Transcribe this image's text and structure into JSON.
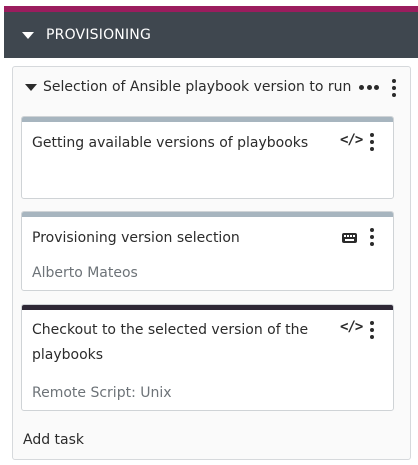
{
  "colors": {
    "accent": "#9b1d5e",
    "header_bg": "#3f474f",
    "card_bar_pending": "#a7b5bf",
    "card_bar_active": "#2f2836"
  },
  "section": {
    "title": "PROVISIONING"
  },
  "group": {
    "title": "Selection of Ansible playbook version to run",
    "add_task_label": "Add task"
  },
  "tasks": [
    {
      "title": "Getting available versions of playbooks",
      "subtitle": "",
      "icon": "code-icon"
    },
    {
      "title": "Provisioning version selection",
      "subtitle": "Alberto Mateos",
      "icon": "keyboard-icon"
    },
    {
      "title_line1": "Checkout to the selected version of the",
      "title_line2": "playbooks",
      "subtitle": "Remote Script: Unix",
      "icon": "code-icon"
    }
  ]
}
